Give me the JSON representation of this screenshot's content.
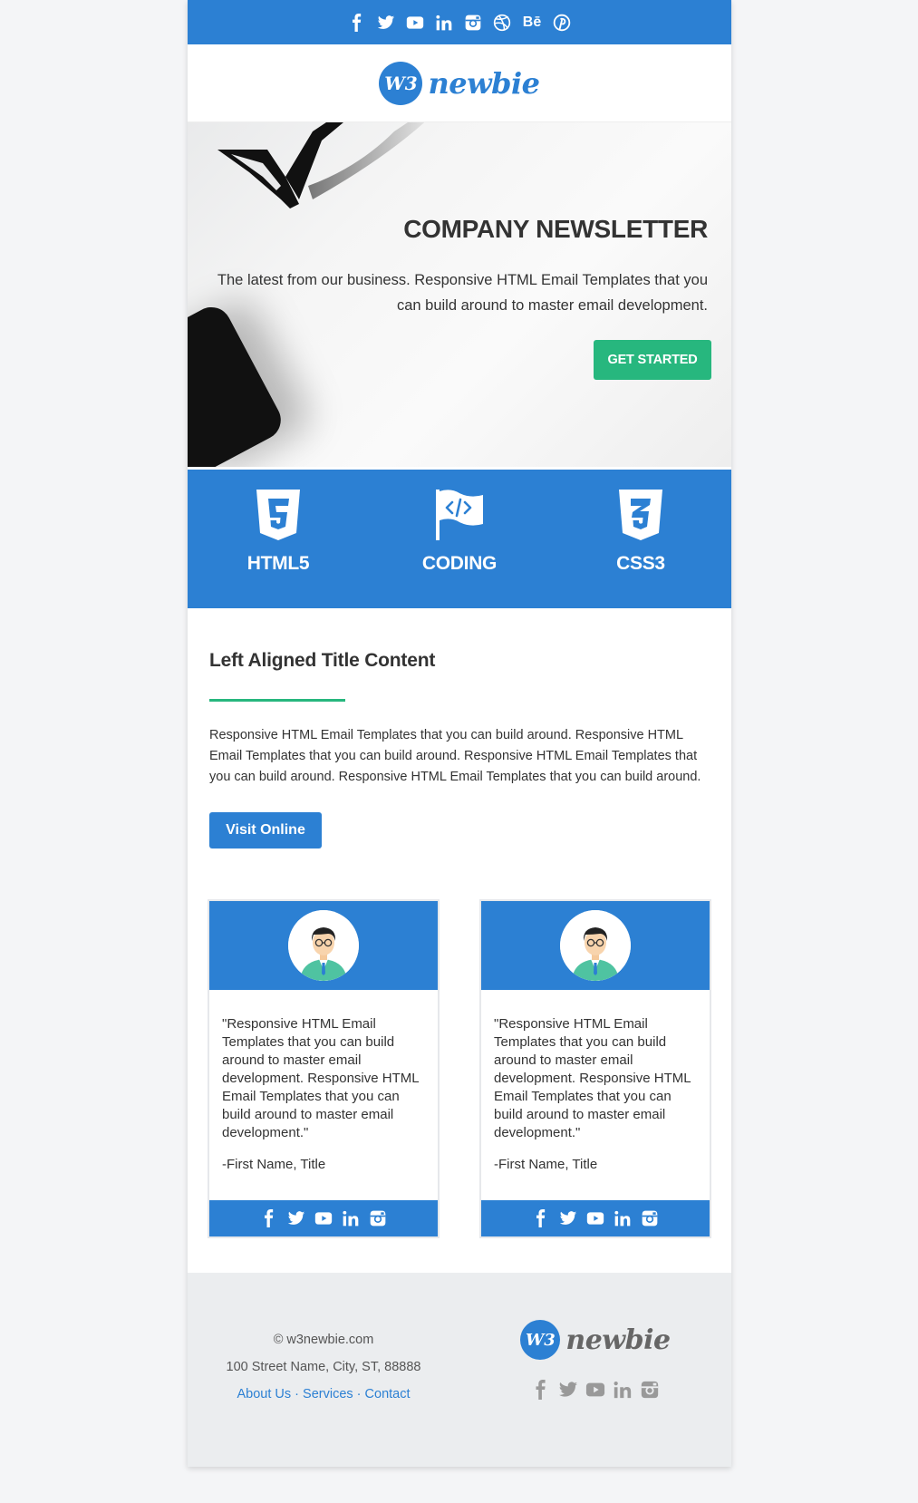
{
  "top_social_icons": [
    "facebook-icon",
    "twitter-icon",
    "youtube-icon",
    "linkedin-icon",
    "instagram-icon",
    "dribbble-icon",
    "behance-icon",
    "pinterest-icon"
  ],
  "behance_text": "Bē",
  "logo": {
    "badge": "W3",
    "text": "newbie"
  },
  "hero": {
    "title": "COMPANY NEWSLETTER",
    "text": "The latest from our business. Responsive HTML Email Templates that you can build around to master email development.",
    "button": "GET STARTED"
  },
  "features": [
    {
      "label": "HTML5",
      "icon": "html5-icon"
    },
    {
      "label": "CODING",
      "icon": "code-flag-icon"
    },
    {
      "label": "CSS3",
      "icon": "css3-icon"
    }
  ],
  "section": {
    "title": "Left Aligned Title Content",
    "text": "Responsive HTML Email Templates that you can build around. Responsive HTML Email Templates that you can build around. Responsive HTML Email Templates that you can build around. Responsive HTML Email Templates that you can build around.",
    "button": "Visit Online"
  },
  "cards": [
    {
      "quote": "\"Responsive HTML Email Templates that you can build around to master email development. Responsive HTML Email Templates that you can build around to master email development.\"",
      "signature": "-First Name, Title"
    },
    {
      "quote": "\"Responsive HTML Email Templates that you can build around to master email development. Responsive HTML Email Templates that you can build around to master email development.\"",
      "signature": "-First Name, Title"
    }
  ],
  "footer": {
    "copyright": "© w3newbie.com",
    "address": "100 Street Name, City, ST, 88888",
    "links": [
      "About Us",
      "Services",
      "Contact"
    ],
    "separator": " · "
  },
  "colors": {
    "brand_blue": "#2c80d3",
    "accent_green": "#27b77e",
    "footer_bg": "#ebedef"
  }
}
